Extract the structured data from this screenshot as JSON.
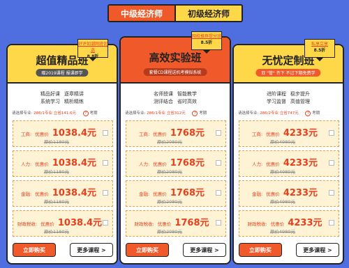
{
  "tabs": [
    {
      "label": "中级经济师",
      "active": true
    },
    {
      "label": "初级经济师",
      "active": false
    }
  ],
  "colors": {
    "background": "#4f6fe0",
    "accent": "#f05a2a",
    "yellow": "#ffd84a"
  },
  "cards": [
    {
      "title": "超值精品班",
      "subtitle": "赠2019课程 报课即学",
      "ribbon": {
        "line1": "好评如潮网班优选",
        "line2": "8.8折"
      },
      "features": [
        [
          "精品好课",
          "逐章精讲"
        ],
        [
          "系统学习",
          "精析精练"
        ]
      ],
      "select": {
        "label": "请选择专业:",
        "price": "286/1专业 立省141.6元",
        "help": "?",
        "help_label": "考期"
      },
      "options": [
        {
          "name": "工商:",
          "prefix": "优惠价",
          "price": "1038.4元",
          "orig": "原价1180元"
        },
        {
          "name": "人力:",
          "prefix": "优惠价",
          "price": "1038.4元",
          "orig": "原价1180元"
        },
        {
          "name": "金融:",
          "prefix": "优惠价",
          "price": "1038.4元",
          "orig": "原价1180元"
        },
        {
          "name": "财政税收:",
          "prefix": "优惠价",
          "price": "1038.4元",
          "orig": "原价1180元"
        }
      ],
      "buy": "立即购买",
      "more": "更多课程 >"
    },
    {
      "title": "高效实验班",
      "subtitle": "套餐CD课程送机考模拟系统",
      "ribbon": {
        "line1": "网校推荐提分班",
        "line2": "8.5折"
      },
      "features": [
        [
          "名师授课",
          "智能教学"
        ],
        [
          "测评结合",
          "省时高效"
        ]
      ],
      "select": {
        "label": "请选择专业:",
        "price": "286/1专业 立省312元",
        "help": "?",
        "help_label": "考期"
      },
      "options": [
        {
          "name": "工商:",
          "prefix": "优惠价",
          "price": "1768元",
          "orig": "原价2080元"
        },
        {
          "name": "人力:",
          "prefix": "优惠价",
          "price": "1768元",
          "orig": "原价2080元"
        },
        {
          "name": "金融:",
          "prefix": "优惠价",
          "price": "1768元",
          "orig": "原价2080元"
        },
        {
          "name": "财政税收:",
          "prefix": "优惠价",
          "price": "1768元",
          "orig": "原价2080元"
        }
      ],
      "buy": "立即购买",
      "more": "更多课程 >"
    },
    {
      "title": "无忧定制班",
      "subtitle": "双 \"管\" 齐下 不过下期免费学",
      "ribbon": {
        "line1": "私享立享",
        "line2": "8.5折"
      },
      "features": [
        [
          "进阶课程",
          "稳步提升"
        ],
        [
          "学习监督",
          "高值管理"
        ]
      ],
      "select": {
        "label": "请选择专业:",
        "price": "286/2专业 立省747元",
        "help": "?",
        "help_label": "考期"
      },
      "options": [
        {
          "name": "工商:",
          "prefix": "优惠价",
          "price": "4233元",
          "orig": "原价4980元"
        },
        {
          "name": "人力:",
          "prefix": "优惠价",
          "price": "4233元",
          "orig": "原价4980元"
        },
        {
          "name": "金融:",
          "prefix": "优惠价",
          "price": "4233元",
          "orig": "原价4980元"
        },
        {
          "name": "财政税收:",
          "prefix": "优惠价",
          "price": "4233元",
          "orig": "原价4980元"
        }
      ],
      "buy": "立即购买",
      "more": "更多课程 >"
    }
  ]
}
